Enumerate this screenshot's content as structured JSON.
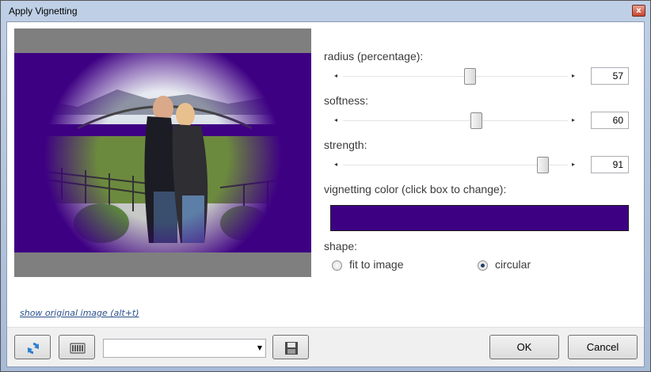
{
  "window": {
    "title": "Apply Vignetting",
    "close_glyph": "x"
  },
  "preview": {
    "show_original_link": "show original image (alt+t)"
  },
  "controls": {
    "radius": {
      "label": "radius (percentage):",
      "value": 57,
      "min": 0,
      "max": 100
    },
    "softness": {
      "label": "softness:",
      "value": 60,
      "min": 0,
      "max": 100
    },
    "strength": {
      "label": "strength:",
      "value": 91,
      "min": 0,
      "max": 100
    },
    "vignetting_color": {
      "label": "vignetting color (click box to change):",
      "color": "#3E0083"
    },
    "shape": {
      "label": "shape:",
      "options": [
        {
          "label": "fit to image",
          "selected": false
        },
        {
          "label": "circular",
          "selected": true
        }
      ]
    }
  },
  "footer": {
    "refresh_icon": "refresh-icon",
    "randomize_icon": "keyboard-icon",
    "preset_value": "",
    "save_icon": "save-icon",
    "ok_label": "OK",
    "cancel_label": "Cancel"
  }
}
